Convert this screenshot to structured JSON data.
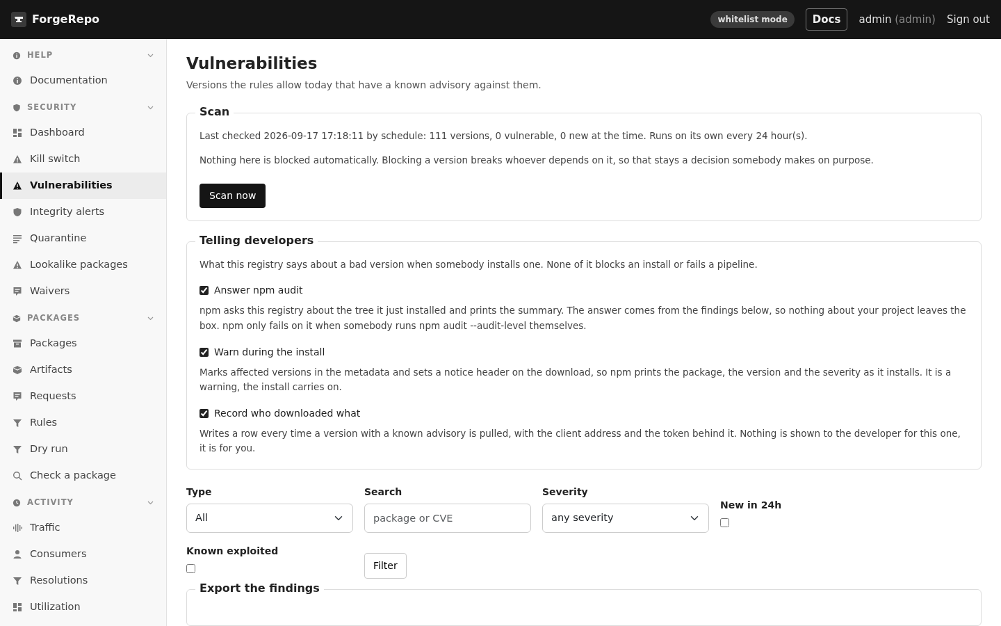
{
  "brand": {
    "name": "ForgeRepo"
  },
  "header": {
    "mode_badge": "whitelist mode",
    "docs": "Docs",
    "user": "admin",
    "role": "(admin)",
    "sign_out": "Sign out"
  },
  "sidebar": {
    "sections": [
      {
        "label": "HELP",
        "expanded": true,
        "items": [
          {
            "label": "Documentation",
            "selected": false
          }
        ]
      },
      {
        "label": "SECURITY",
        "expanded": true,
        "items": [
          {
            "label": "Dashboard",
            "selected": false
          },
          {
            "label": "Kill switch",
            "selected": false
          },
          {
            "label": "Vulnerabilities",
            "selected": true
          },
          {
            "label": "Integrity alerts",
            "selected": false
          },
          {
            "label": "Quarantine",
            "selected": false
          },
          {
            "label": "Lookalike packages",
            "selected": false
          },
          {
            "label": "Waivers",
            "selected": false
          }
        ]
      },
      {
        "label": "PACKAGES",
        "expanded": true,
        "items": [
          {
            "label": "Packages",
            "selected": false
          },
          {
            "label": "Artifacts",
            "selected": false
          },
          {
            "label": "Requests",
            "selected": false
          },
          {
            "label": "Rules",
            "selected": false
          },
          {
            "label": "Dry run",
            "selected": false
          },
          {
            "label": "Check a package",
            "selected": false
          }
        ]
      },
      {
        "label": "ACTIVITY",
        "expanded": true,
        "items": [
          {
            "label": "Traffic",
            "selected": false
          },
          {
            "label": "Consumers",
            "selected": false
          },
          {
            "label": "Resolutions",
            "selected": false
          },
          {
            "label": "Utilization",
            "selected": false
          }
        ]
      }
    ]
  },
  "page": {
    "title": "Vulnerabilities",
    "subtitle": "Versions the rules allow today that have a known advisory against them."
  },
  "scan": {
    "legend": "Scan",
    "paragraphs": [
      "Last checked 2026-09-17 17:18:11 by schedule: 111 versions, 0 vulnerable, 0 new at the time. Runs on its own every 24 hour(s).",
      "Nothing here is blocked automatically. Blocking a version breaks whoever depends on it, so that stays a decision somebody makes on purpose."
    ],
    "button": "Scan now"
  },
  "telling": {
    "legend": "Telling developers",
    "intro": "What this registry says about a bad version when somebody installs one. None of it blocks an install or fails a pipeline.",
    "options": [
      {
        "label": "Answer npm audit",
        "checked": true,
        "help": "npm asks this registry about the tree it just installed and prints the summary. The answer comes from the findings below, so nothing about your project leaves the box. npm only fails on it when somebody runs npm audit --audit-level themselves."
      },
      {
        "label": "Warn during the install",
        "checked": true,
        "help": "Marks affected versions in the metadata and sets a notice header on the download, so npm prints the package, the version and the severity as it installs. It is a warning, the install carries on."
      },
      {
        "label": "Record who downloaded what",
        "checked": true,
        "help": "Writes a row every time a version with a known advisory is pulled, with the client address and the token behind it. Nothing is shown to the developer for this one, it is for you."
      }
    ]
  },
  "filters": [
    {
      "kind": "select",
      "label": "Type",
      "value": "All"
    },
    {
      "kind": "text",
      "label": "Search",
      "placeholder": "package or CVE"
    },
    {
      "kind": "select",
      "label": "Severity",
      "value": "any severity"
    },
    {
      "kind": "checkbox",
      "label": "New in 24h",
      "checked": false
    },
    {
      "kind": "checkbox",
      "label": "Known exploited",
      "checked": false
    },
    {
      "kind": "button",
      "label": "Filter"
    }
  ],
  "export": {
    "legend": "Export the findings"
  }
}
